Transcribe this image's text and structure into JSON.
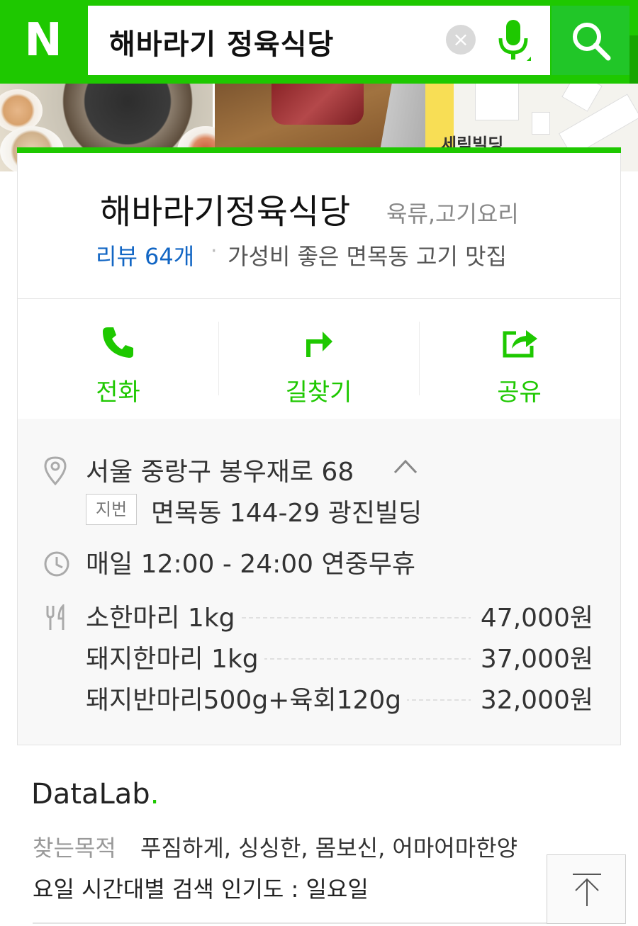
{
  "header": {
    "logo": "N",
    "search_query": "해바라기 정육식당",
    "clear_glyph": "×"
  },
  "photos": {
    "map_label": "세림빌딩"
  },
  "place": {
    "name": "해바라기정육식당",
    "category": "육류,고기요리",
    "review_link": "리뷰 64개",
    "separator": "·",
    "tagline": "가성비 좋은 면목동 고기 맛집"
  },
  "actions": [
    {
      "label": "전화",
      "icon": "phone-icon"
    },
    {
      "label": "길찾기",
      "icon": "directions-icon"
    },
    {
      "label": "공유",
      "icon": "share-icon"
    }
  ],
  "details": {
    "address": "서울 중랑구 봉우재로 68",
    "jibun_badge": "지번",
    "jibun_address": "면목동 144-29 광진빌딩",
    "hours": "매일 12:00 - 24:00 연중무휴",
    "menu": [
      {
        "name": "소한마리 1kg",
        "price": "47,000원"
      },
      {
        "name": "돼지한마리 1kg",
        "price": "37,000원"
      },
      {
        "name": "돼지반마리500g+육회120g",
        "price": "32,000원"
      }
    ]
  },
  "datalab": {
    "logo_text": "DataLab",
    "logo_dot": ".",
    "purpose_label": "찾는목적",
    "purpose_values": "푸짐하게, 싱싱한, 몸보신, 어마어마한양",
    "popularity": "요일 시간대별 검색 인기도 : 일요일"
  },
  "colors": {
    "brand_green": "#1ec800",
    "link_blue": "#1266c4"
  }
}
